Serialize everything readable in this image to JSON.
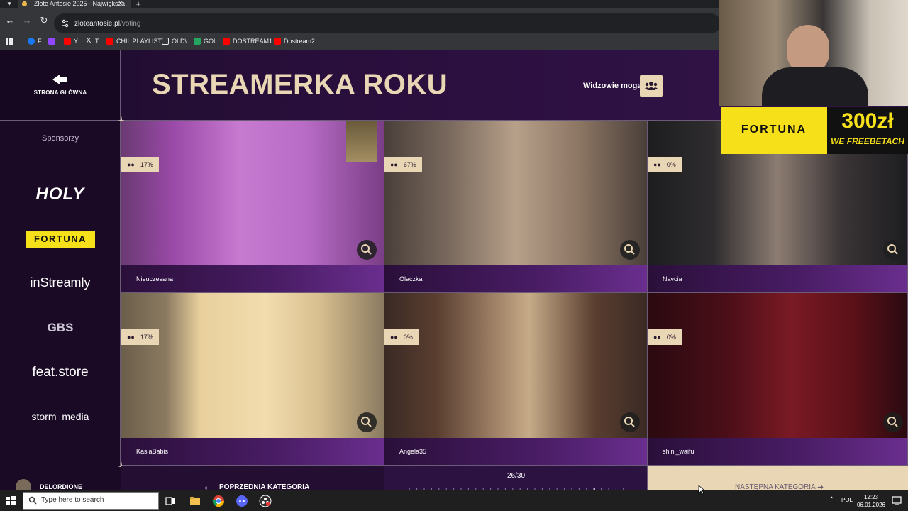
{
  "browser": {
    "tab_title": "Złote Antosie 2025 - Największa",
    "url_host": "zloteantosie.pl",
    "url_path": "/voting",
    "bookmarks": [
      "F",
      "",
      "Y",
      "T",
      "CHIL PLAYLIST",
      "OLD\\",
      "GOL",
      "DOSTREAM1",
      "Dostream2"
    ]
  },
  "site": {
    "home_label": "STRONA GŁÓWNA",
    "title": "STREAMERKA ROKU",
    "viewers_label": "Widzowie mogą",
    "sponsors_title": "Sponsorzy",
    "sponsors": [
      "HOLY",
      "FORTUNA",
      "inStreamly",
      "GBS",
      "feat.store",
      "storm_media"
    ],
    "nominees": [
      {
        "name": "Nieuczesana",
        "percent": "17%"
      },
      {
        "name": "Olaczka",
        "percent": "67%"
      },
      {
        "name": "Navcia",
        "percent": "0%"
      },
      {
        "name": "KasiaBabis",
        "percent": "17%"
      },
      {
        "name": "Angela35",
        "percent": "0%"
      },
      {
        "name": "shini_waifu",
        "percent": "0%"
      }
    ],
    "bottom": {
      "user_name": "DELORDIONE",
      "prev_label": "POPRZEDNIA KATEGORIA",
      "progress_text": "26/30",
      "progress_value": 26,
      "progress_total": 30,
      "next_label": "NASTĘPNA KATEGORIA"
    }
  },
  "overlay": {
    "ad_brand": "FORTUNA",
    "ad_amount": "300zł",
    "ad_promo": "WE FREEBETACH"
  },
  "taskbar": {
    "search_placeholder": "Type here to search",
    "language": "POL",
    "time": "12:23",
    "date": "06.01.2026"
  },
  "colors": {
    "accent_gold": "#e9d6b4",
    "bg_purple": "#1c0b2a",
    "caption_purple": "#6a2e8e",
    "fortuna_yellow": "#f6e01a"
  }
}
